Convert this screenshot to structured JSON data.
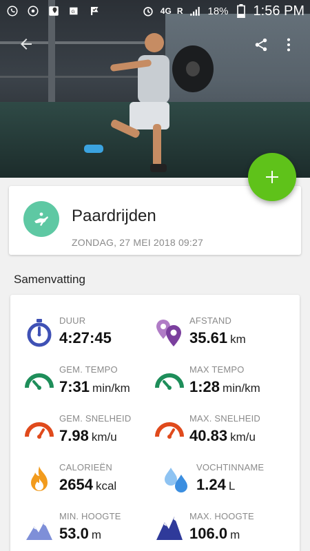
{
  "status_bar": {
    "time": "1:56 PM",
    "battery": "18%",
    "network": "4G",
    "roaming": "R"
  },
  "activity": {
    "title": "Paardrijden",
    "date": "ZONDAG, 27 MEI 2018 09:27"
  },
  "section_title": "Samenvatting",
  "stats": [
    {
      "label": "DUUR",
      "value": "4:27:45",
      "unit": "",
      "icon": "stopwatch-icon",
      "color": "#3f51b5"
    },
    {
      "label": "AFSTAND",
      "value": "35.61",
      "unit": "km",
      "icon": "location-pins-icon",
      "color": "#7b3f9e"
    },
    {
      "label": "GEM. TEMPO",
      "value": "7:31",
      "unit": "min/km",
      "icon": "tempo-gauge-icon",
      "color": "#1e8e5a"
    },
    {
      "label": "MAX TEMPO",
      "value": "1:28",
      "unit": "min/km",
      "icon": "tempo-gauge-icon",
      "color": "#1e8e5a"
    },
    {
      "label": "GEM. SNELHEID",
      "value": "7.98",
      "unit": "km/u",
      "icon": "speed-gauge-icon",
      "color": "#e04a1c"
    },
    {
      "label": "MAX. SNELHEID",
      "value": "40.83",
      "unit": "km/u",
      "icon": "speed-gauge-icon",
      "color": "#e04a1c"
    },
    {
      "label": "CALORIEËN",
      "value": "2654",
      "unit": "kcal",
      "icon": "flame-icon",
      "color": "#f29b1d"
    },
    {
      "label": "VOCHTINNAME",
      "value": "1.24",
      "unit": "L",
      "icon": "water-drops-icon",
      "color": "#3b8ee0"
    },
    {
      "label": "MIN. HOOGTE",
      "value": "53.0",
      "unit": "m",
      "icon": "mountain-icon",
      "color": "#5a6cc8"
    },
    {
      "label": "MAX. HOOGTE",
      "value": "106.0",
      "unit": "m",
      "icon": "mountain-icon",
      "color": "#2f3a9a"
    }
  ]
}
